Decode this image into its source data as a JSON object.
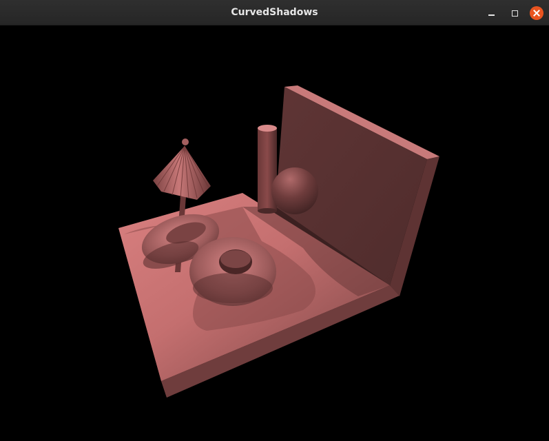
{
  "window": {
    "title": "CurvedShadows",
    "controls": [
      "minimize",
      "maximize",
      "close"
    ]
  },
  "scene": {
    "colors": {
      "background": "#000000",
      "lit_surface": "#e88a8a",
      "shadow_surface": "#6e3d3d",
      "wall": "#5a3232"
    },
    "objects": [
      "floor",
      "wall",
      "umbrella",
      "cylinder",
      "sphere",
      "torus-large",
      "torus-small"
    ]
  }
}
